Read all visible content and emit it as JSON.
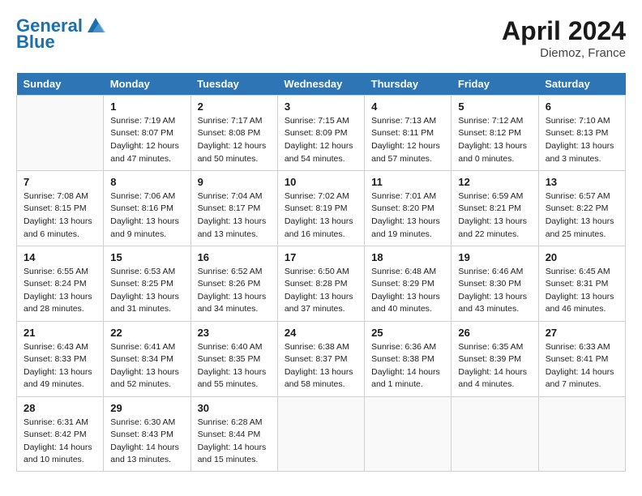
{
  "header": {
    "logo_line1": "General",
    "logo_line2": "Blue",
    "month_year": "April 2024",
    "location": "Diemoz, France"
  },
  "days_of_week": [
    "Sunday",
    "Monday",
    "Tuesday",
    "Wednesday",
    "Thursday",
    "Friday",
    "Saturday"
  ],
  "weeks": [
    [
      {
        "day": "",
        "sunrise": "",
        "sunset": "",
        "daylight": ""
      },
      {
        "day": "1",
        "sunrise": "Sunrise: 7:19 AM",
        "sunset": "Sunset: 8:07 PM",
        "daylight": "Daylight: 12 hours and 47 minutes."
      },
      {
        "day": "2",
        "sunrise": "Sunrise: 7:17 AM",
        "sunset": "Sunset: 8:08 PM",
        "daylight": "Daylight: 12 hours and 50 minutes."
      },
      {
        "day": "3",
        "sunrise": "Sunrise: 7:15 AM",
        "sunset": "Sunset: 8:09 PM",
        "daylight": "Daylight: 12 hours and 54 minutes."
      },
      {
        "day": "4",
        "sunrise": "Sunrise: 7:13 AM",
        "sunset": "Sunset: 8:11 PM",
        "daylight": "Daylight: 12 hours and 57 minutes."
      },
      {
        "day": "5",
        "sunrise": "Sunrise: 7:12 AM",
        "sunset": "Sunset: 8:12 PM",
        "daylight": "Daylight: 13 hours and 0 minutes."
      },
      {
        "day": "6",
        "sunrise": "Sunrise: 7:10 AM",
        "sunset": "Sunset: 8:13 PM",
        "daylight": "Daylight: 13 hours and 3 minutes."
      }
    ],
    [
      {
        "day": "7",
        "sunrise": "Sunrise: 7:08 AM",
        "sunset": "Sunset: 8:15 PM",
        "daylight": "Daylight: 13 hours and 6 minutes."
      },
      {
        "day": "8",
        "sunrise": "Sunrise: 7:06 AM",
        "sunset": "Sunset: 8:16 PM",
        "daylight": "Daylight: 13 hours and 9 minutes."
      },
      {
        "day": "9",
        "sunrise": "Sunrise: 7:04 AM",
        "sunset": "Sunset: 8:17 PM",
        "daylight": "Daylight: 13 hours and 13 minutes."
      },
      {
        "day": "10",
        "sunrise": "Sunrise: 7:02 AM",
        "sunset": "Sunset: 8:19 PM",
        "daylight": "Daylight: 13 hours and 16 minutes."
      },
      {
        "day": "11",
        "sunrise": "Sunrise: 7:01 AM",
        "sunset": "Sunset: 8:20 PM",
        "daylight": "Daylight: 13 hours and 19 minutes."
      },
      {
        "day": "12",
        "sunrise": "Sunrise: 6:59 AM",
        "sunset": "Sunset: 8:21 PM",
        "daylight": "Daylight: 13 hours and 22 minutes."
      },
      {
        "day": "13",
        "sunrise": "Sunrise: 6:57 AM",
        "sunset": "Sunset: 8:22 PM",
        "daylight": "Daylight: 13 hours and 25 minutes."
      }
    ],
    [
      {
        "day": "14",
        "sunrise": "Sunrise: 6:55 AM",
        "sunset": "Sunset: 8:24 PM",
        "daylight": "Daylight: 13 hours and 28 minutes."
      },
      {
        "day": "15",
        "sunrise": "Sunrise: 6:53 AM",
        "sunset": "Sunset: 8:25 PM",
        "daylight": "Daylight: 13 hours and 31 minutes."
      },
      {
        "day": "16",
        "sunrise": "Sunrise: 6:52 AM",
        "sunset": "Sunset: 8:26 PM",
        "daylight": "Daylight: 13 hours and 34 minutes."
      },
      {
        "day": "17",
        "sunrise": "Sunrise: 6:50 AM",
        "sunset": "Sunset: 8:28 PM",
        "daylight": "Daylight: 13 hours and 37 minutes."
      },
      {
        "day": "18",
        "sunrise": "Sunrise: 6:48 AM",
        "sunset": "Sunset: 8:29 PM",
        "daylight": "Daylight: 13 hours and 40 minutes."
      },
      {
        "day": "19",
        "sunrise": "Sunrise: 6:46 AM",
        "sunset": "Sunset: 8:30 PM",
        "daylight": "Daylight: 13 hours and 43 minutes."
      },
      {
        "day": "20",
        "sunrise": "Sunrise: 6:45 AM",
        "sunset": "Sunset: 8:31 PM",
        "daylight": "Daylight: 13 hours and 46 minutes."
      }
    ],
    [
      {
        "day": "21",
        "sunrise": "Sunrise: 6:43 AM",
        "sunset": "Sunset: 8:33 PM",
        "daylight": "Daylight: 13 hours and 49 minutes."
      },
      {
        "day": "22",
        "sunrise": "Sunrise: 6:41 AM",
        "sunset": "Sunset: 8:34 PM",
        "daylight": "Daylight: 13 hours and 52 minutes."
      },
      {
        "day": "23",
        "sunrise": "Sunrise: 6:40 AM",
        "sunset": "Sunset: 8:35 PM",
        "daylight": "Daylight: 13 hours and 55 minutes."
      },
      {
        "day": "24",
        "sunrise": "Sunrise: 6:38 AM",
        "sunset": "Sunset: 8:37 PM",
        "daylight": "Daylight: 13 hours and 58 minutes."
      },
      {
        "day": "25",
        "sunrise": "Sunrise: 6:36 AM",
        "sunset": "Sunset: 8:38 PM",
        "daylight": "Daylight: 14 hours and 1 minute."
      },
      {
        "day": "26",
        "sunrise": "Sunrise: 6:35 AM",
        "sunset": "Sunset: 8:39 PM",
        "daylight": "Daylight: 14 hours and 4 minutes."
      },
      {
        "day": "27",
        "sunrise": "Sunrise: 6:33 AM",
        "sunset": "Sunset: 8:41 PM",
        "daylight": "Daylight: 14 hours and 7 minutes."
      }
    ],
    [
      {
        "day": "28",
        "sunrise": "Sunrise: 6:31 AM",
        "sunset": "Sunset: 8:42 PM",
        "daylight": "Daylight: 14 hours and 10 minutes."
      },
      {
        "day": "29",
        "sunrise": "Sunrise: 6:30 AM",
        "sunset": "Sunset: 8:43 PM",
        "daylight": "Daylight: 14 hours and 13 minutes."
      },
      {
        "day": "30",
        "sunrise": "Sunrise: 6:28 AM",
        "sunset": "Sunset: 8:44 PM",
        "daylight": "Daylight: 14 hours and 15 minutes."
      },
      {
        "day": "",
        "sunrise": "",
        "sunset": "",
        "daylight": ""
      },
      {
        "day": "",
        "sunrise": "",
        "sunset": "",
        "daylight": ""
      },
      {
        "day": "",
        "sunrise": "",
        "sunset": "",
        "daylight": ""
      },
      {
        "day": "",
        "sunrise": "",
        "sunset": "",
        "daylight": ""
      }
    ]
  ]
}
